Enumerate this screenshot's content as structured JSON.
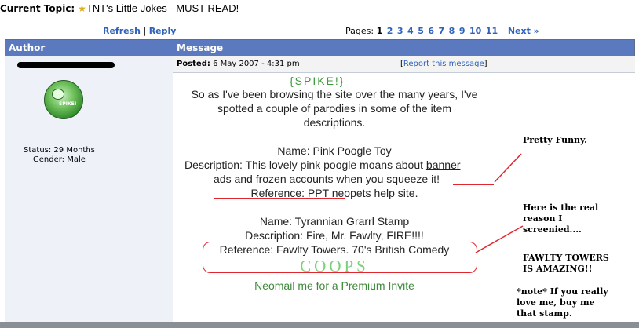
{
  "topic": {
    "label": "Current Topic:",
    "star_icon": "star-icon",
    "title": "TNT's Little Jokes - MUST READ!"
  },
  "toolbar": {
    "refresh": "Refresh",
    "separator": "|",
    "reply": "Reply",
    "pages_label": "Pages:",
    "current_page": "1",
    "pages": [
      "2",
      "3",
      "4",
      "5",
      "6",
      "7",
      "8",
      "9",
      "10",
      "11"
    ],
    "next": "Next »"
  },
  "table": {
    "author_header": "Author",
    "message_header": "Message"
  },
  "author": {
    "status": "Status: 29 Months",
    "gender": "Gender: Male",
    "avatar_text": "SPIKE!"
  },
  "post": {
    "posted_label": "Posted:",
    "posted_date": "6 May 2007 - 4:31 pm",
    "report_open": "[",
    "report_link": "Report this message",
    "report_close": "]",
    "spike": "{SPIKE!}",
    "intro1": "So as I've been browsing the site over the many years, I've",
    "intro2": "spotted a couple of parodies in some of the item",
    "intro3": "descriptions.",
    "item1_name": "Name: Pink Poogle Toy",
    "item1_desc_a": "Description: This lovely pink poogle moans about ",
    "item1_desc_b": "banner",
    "item1_desc_c": "ads and frozen accounts",
    "item1_desc_d": " when you squeeze it!",
    "item1_ref": "Reference: PPT neopets help site.",
    "item2_name": "Name: Tyrannian Grarrl Stamp",
    "item2_desc": "Description: Fire, Mr. Fawlty, FIRE!!!!",
    "item2_ref": "Reference: Fawlty Towers. 70's British Comedy",
    "coops": "COOPS",
    "invite": "Neomail me for a Premium Invite"
  },
  "annotations": {
    "funny": "Pretty Funny.",
    "real_reason": "Here is the real\nreason I\nscreenied....",
    "fawlty": "FAWLTY TOWERS\nIS AMAZING!!",
    "note": "*note* If you really\nlove me, buy me\nthat stamp."
  },
  "colors": {
    "header_blue": "#5a79bf",
    "link_blue": "#2f62b8",
    "annotation_red": "#e0262c",
    "green_text": "#3d8a3a"
  }
}
